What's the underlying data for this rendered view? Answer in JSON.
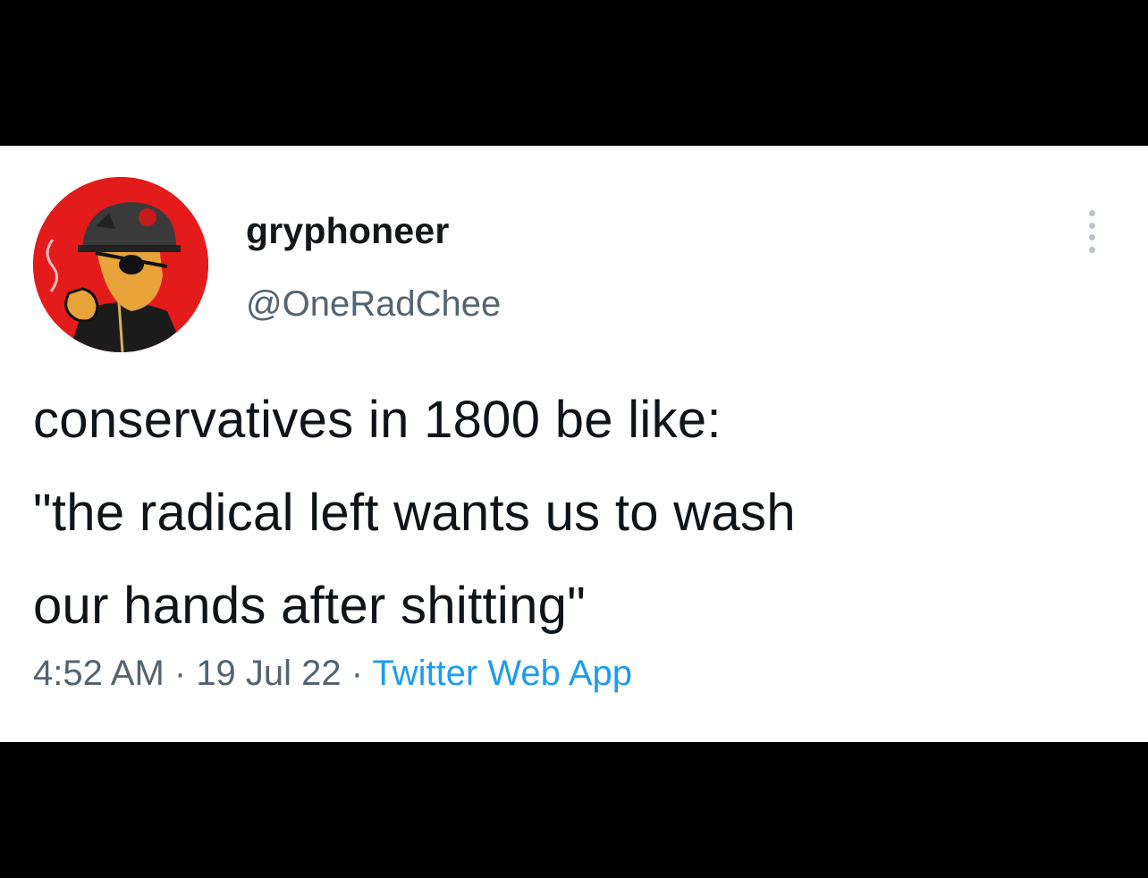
{
  "tweet": {
    "display_name": "gryphoneer",
    "handle": "@OneRadChee",
    "text_lines": [
      "conservatives in 1800 be like:",
      "\"the radical left wants us to wash",
      "our hands after shitting\""
    ],
    "time": "4:52 AM",
    "separator": " · ",
    "date": "19 Jul 22",
    "source": "Twitter Web App",
    "avatar_icon": "pirate-character-avatar",
    "more_icon": "more-options-icon"
  },
  "colors": {
    "background_bars": "#000000",
    "card": "#ffffff",
    "text": "#0f1419",
    "muted": "#536471",
    "link": "#1d9bf0",
    "avatar_bg": "#e41b1b"
  }
}
